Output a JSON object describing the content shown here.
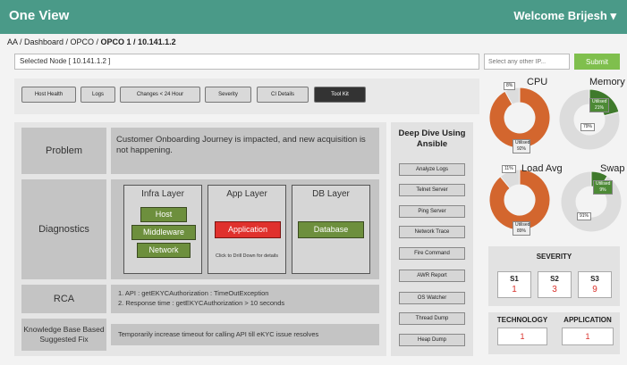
{
  "app": {
    "title": "One View",
    "welcome": "Welcome Brijesh"
  },
  "breadcrumb": {
    "path": "AA / Dashboard / OPCO / ",
    "current": "OPCO 1 / 10.141.1.2"
  },
  "selected_node": "Selected Node [ 10.141.1.2 ]",
  "ip_input": {
    "placeholder": "Select any other IP..."
  },
  "submit_label": "Submit",
  "tabs": [
    "Host Health",
    "Logs",
    "Changes < 24 Hour",
    "Severity",
    "CI Details",
    "Tool Kit"
  ],
  "rows": {
    "problem": {
      "label": "Problem",
      "text": "Customer Onboarding Journey is impacted, and new acquisition is not happening."
    },
    "diagnostics": {
      "label": "Diagnostics"
    },
    "rca": {
      "label": "RCA",
      "items": [
        "1.   API : getEKYCAuthorization : TimeOutException",
        "2.   Response time : getEKYCAuthorization > 10 seconds"
      ]
    },
    "kb": {
      "label": "Knowledge Base Based Suggested Fix",
      "text": "Temporarily increase timeout for calling API till eKYC issue resolves"
    }
  },
  "layers": {
    "infra": {
      "title": "Infra Layer",
      "items": [
        "Host",
        "Middleware",
        "Network"
      ]
    },
    "app": {
      "title": "App Layer",
      "item": "Application",
      "note": "Click to Drill Down for details"
    },
    "db": {
      "title": "DB Layer",
      "item": "Database"
    }
  },
  "deep_dive": {
    "title": "Deep Dive Using Ansible",
    "buttons": [
      "Analyze Logs",
      "Telnet Server",
      "Ping Server",
      "Network Trace",
      "Fire Command",
      "AWR Report",
      "OS Watcher",
      "Thread Dump",
      "Heap Dump"
    ]
  },
  "metrics": {
    "cpu": {
      "label": "CPU",
      "free": "8%",
      "utilised": "Utilised 92%"
    },
    "memory": {
      "label": "Memory",
      "free": "79%",
      "utilised": "Utilised 21%"
    },
    "load": {
      "label": "Load Avg",
      "free": "11%",
      "utilised": "Utilised 89%"
    },
    "swap": {
      "label": "Swap",
      "free": "91%",
      "utilised": "Utilised 9%"
    }
  },
  "chart_data": [
    {
      "type": "pie",
      "title": "CPU",
      "values": [
        92,
        8
      ],
      "labels": [
        "Utilised",
        "Free"
      ],
      "colors": [
        "#d3662e",
        "#dcdcdc"
      ]
    },
    {
      "type": "pie",
      "title": "Memory",
      "values": [
        21,
        79
      ],
      "labels": [
        "Utilised",
        "Free"
      ],
      "colors": [
        "#3f7a2c",
        "#dcdcdc"
      ]
    },
    {
      "type": "pie",
      "title": "Load Avg",
      "values": [
        89,
        11
      ],
      "labels": [
        "Utilised",
        "Free"
      ],
      "colors": [
        "#d3662e",
        "#dcdcdc"
      ]
    },
    {
      "type": "pie",
      "title": "Swap",
      "values": [
        9,
        91
      ],
      "labels": [
        "Utilised",
        "Free"
      ],
      "colors": [
        "#3f7a2c",
        "#dcdcdc"
      ]
    }
  ],
  "severity": {
    "title": "SEVERITY",
    "items": [
      {
        "name": "S1",
        "value": "1"
      },
      {
        "name": "S2",
        "value": "3"
      },
      {
        "name": "S3",
        "value": "9"
      }
    ]
  },
  "technology": {
    "label": "TECHNOLOGY",
    "value": "1"
  },
  "application": {
    "label": "APPLICATION",
    "value": "1"
  }
}
